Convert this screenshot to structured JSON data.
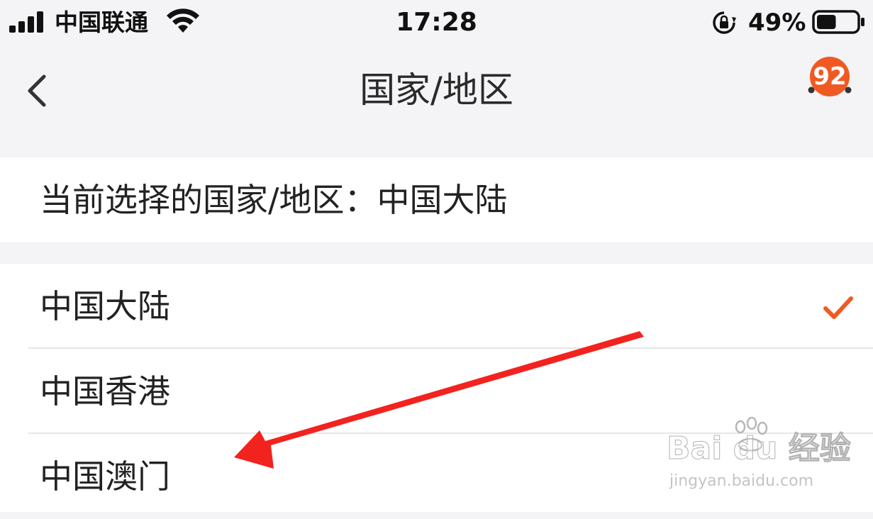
{
  "status_bar": {
    "carrier": "中国联通",
    "time": "17:28",
    "battery_percent": "49%",
    "battery_level": 0.49,
    "icons": [
      "signal-icon",
      "wifi-icon",
      "orientation-lock-icon",
      "battery-icon"
    ]
  },
  "nav": {
    "title": "国家/地区",
    "back_icon": "chevron-left-icon",
    "more_icon": "more-dots-icon",
    "badge_count": "92"
  },
  "current": {
    "text": "当前选择的国家/地区：中国大陆"
  },
  "list": {
    "items": [
      {
        "label": "中国大陆",
        "selected": true
      },
      {
        "label": "中国香港",
        "selected": false
      },
      {
        "label": "中国澳门",
        "selected": false
      }
    ]
  },
  "annotation": {
    "arrow_color": "#f2231f"
  },
  "watermark": {
    "brand": "Bai du 经验",
    "url": "jingyan.baidu.com"
  },
  "colors": {
    "accent": "#f05a22",
    "background": "#f4f3f5",
    "panel": "#ffffff"
  }
}
